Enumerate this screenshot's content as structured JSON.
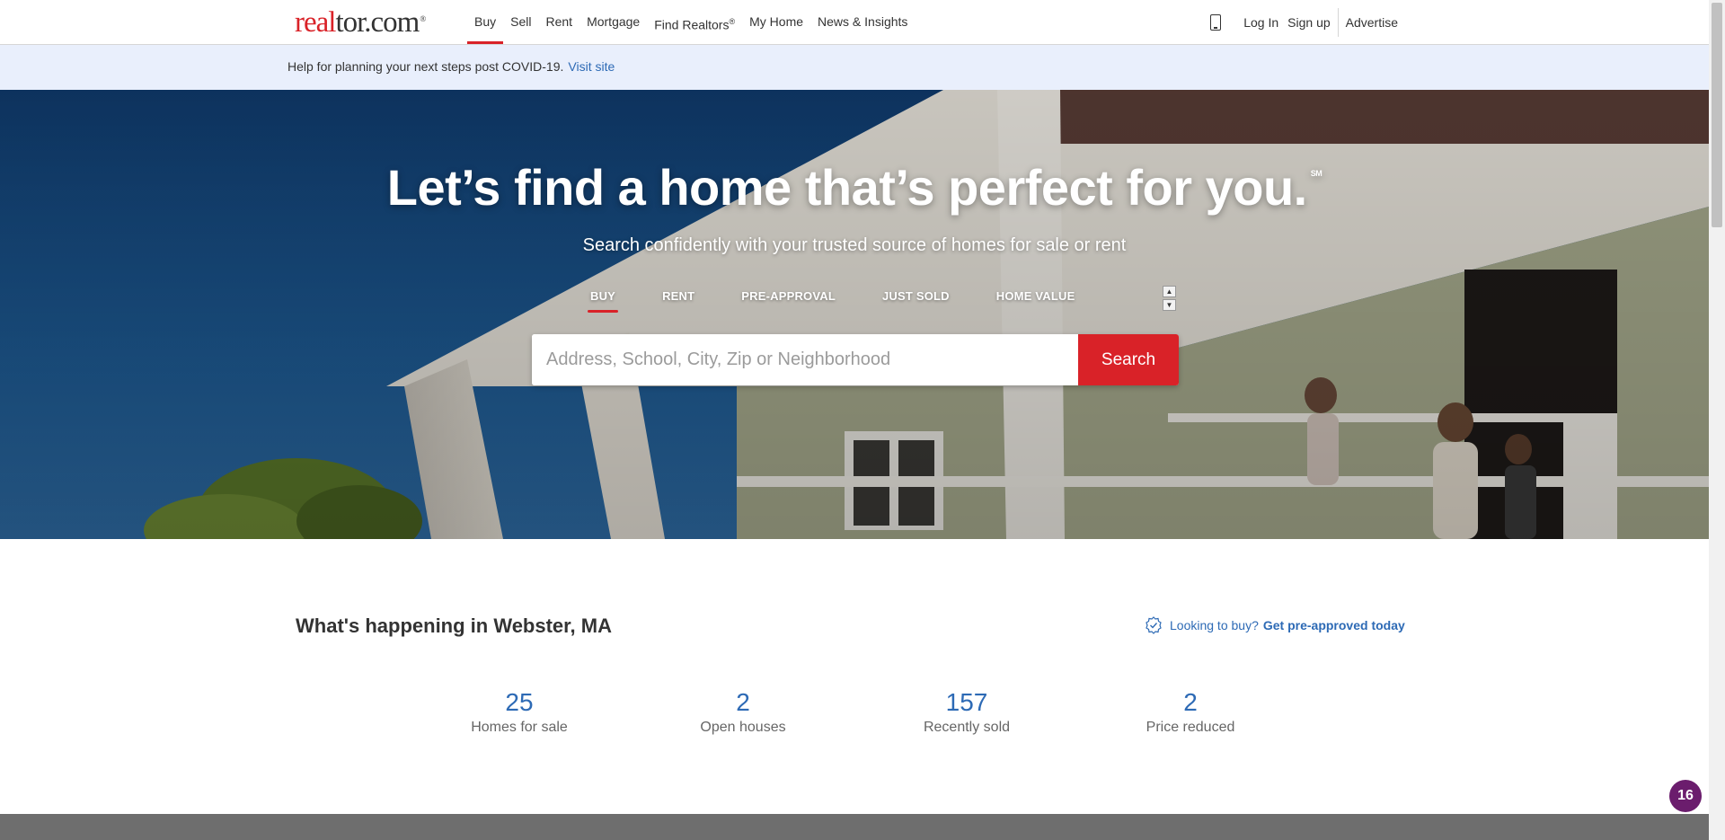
{
  "header": {
    "logo": {
      "part1": "real",
      "part2": "tor.com",
      "mark": "®"
    },
    "nav": [
      {
        "label": "Buy",
        "active": true
      },
      {
        "label": "Sell"
      },
      {
        "label": "Rent"
      },
      {
        "label": "Mortgage"
      },
      {
        "label": "Find Realtors",
        "sup": "®"
      },
      {
        "label": "My Home"
      },
      {
        "label": "News & Insights"
      }
    ],
    "right": {
      "phone_icon": "mobile-phone-icon",
      "login": "Log In",
      "signup": "Sign up",
      "advertise": "Advertise"
    }
  },
  "banner": {
    "text": "Help for planning your next steps post COVID-19.",
    "link": "Visit site"
  },
  "hero": {
    "title": "Let’s find a home that’s perfect for you.",
    "title_mark": "SM",
    "subtitle": "Search confidently with your trusted source of homes for sale or rent",
    "tabs": [
      {
        "label": "BUY",
        "active": true
      },
      {
        "label": "RENT"
      },
      {
        "label": "PRE-APPROVAL"
      },
      {
        "label": "JUST SOLD"
      },
      {
        "label": "HOME VALUE"
      }
    ],
    "search": {
      "placeholder": "Address, School, City, Zip or Neighborhood",
      "value": "",
      "button": "Search"
    }
  },
  "happening": {
    "title": "What's happening in Webster, MA",
    "preapproval": {
      "icon": "check-badge-icon",
      "text": "Looking to buy?",
      "link": "Get pre-approved today"
    },
    "stats": [
      {
        "value": "25",
        "label": "Homes for sale"
      },
      {
        "value": "2",
        "label": "Open houses"
      },
      {
        "value": "157",
        "label": "Recently sold"
      },
      {
        "value": "2",
        "label": "Price reduced"
      }
    ]
  },
  "chat_badge": {
    "count": "16"
  },
  "colors": {
    "brand_red": "#d92228",
    "link_blue": "#2d6ab5",
    "banner_bg": "#e9effc",
    "chat_purple": "#6b1d6d"
  }
}
